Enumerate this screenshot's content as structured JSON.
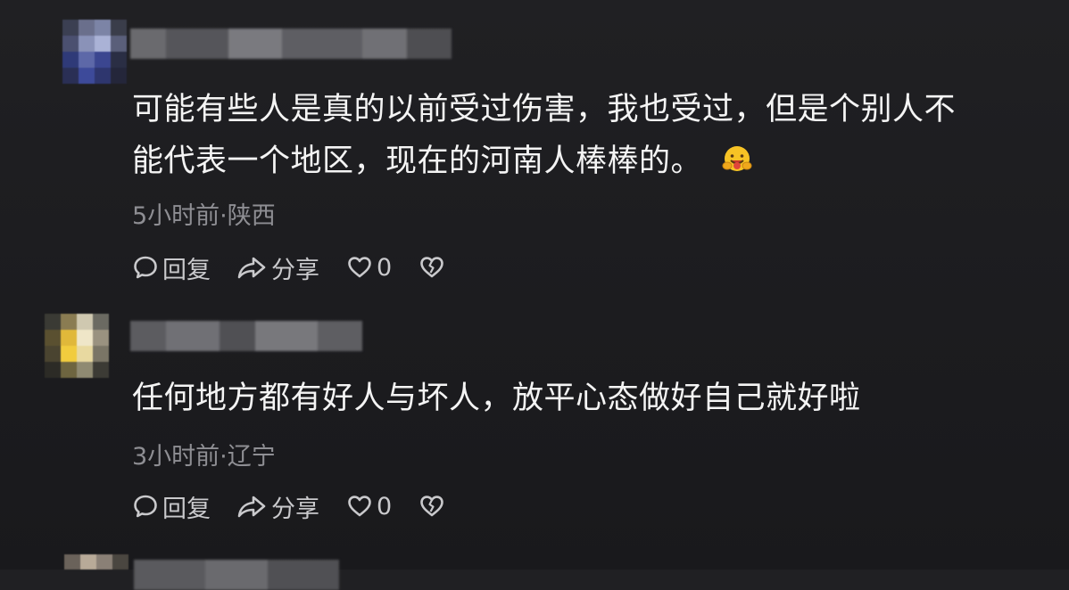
{
  "comments": [
    {
      "text_line1": "可能有些人是真的以前受过伤害，我也受过，但是个别人不",
      "text_line2": "能代表一个地区，现在的河南人棒棒的。",
      "emoji": "hugging-face-emoji",
      "meta": "5小时前·陕西",
      "reply_label": "回复",
      "share_label": "分享",
      "like_count": "0"
    },
    {
      "text_line1": "任何地方都有好人与坏人，放平心态做好自己就好啦",
      "meta": "3小时前·辽宁",
      "reply_label": "回复",
      "share_label": "分享",
      "like_count": "0"
    }
  ],
  "icons": {
    "reply": "comment-bubble-icon",
    "share": "share-arrow-icon",
    "like": "heart-icon",
    "dislike": "broken-heart-icon"
  },
  "colors": {
    "background": "#1e1e21",
    "text": "#f4f4f4",
    "meta": "#8e8e93",
    "action": "#c9c9cc"
  }
}
